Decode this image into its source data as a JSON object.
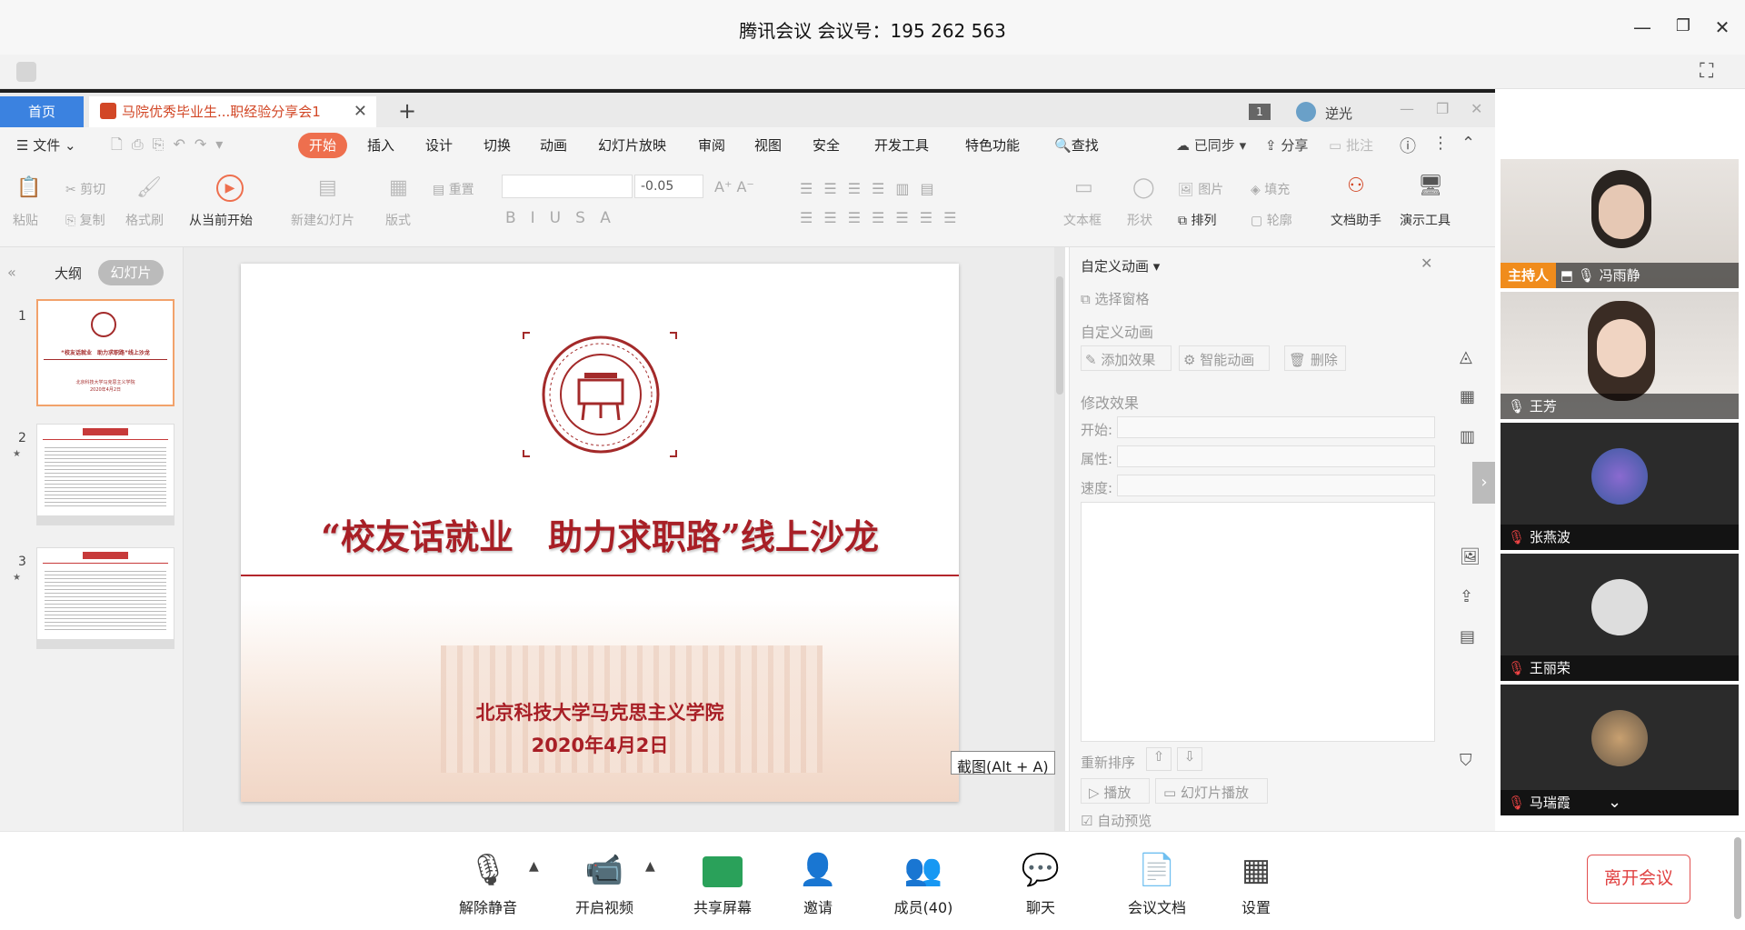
{
  "meeting": {
    "title": "腾讯会议 会议号：195 262 563",
    "leave_label": "离开会议",
    "toolbar": [
      {
        "label": "解除静音",
        "icon": "mic-muted-icon"
      },
      {
        "label": "开启视频",
        "icon": "video-off-icon"
      },
      {
        "label": "共享屏幕",
        "icon": "share-screen-icon"
      },
      {
        "label": "邀请",
        "icon": "invite-icon"
      },
      {
        "label": "成员(40)",
        "icon": "members-icon"
      },
      {
        "label": "聊天",
        "icon": "chat-icon"
      },
      {
        "label": "会议文档",
        "icon": "document-icon"
      },
      {
        "label": "设置",
        "icon": "settings-icon"
      }
    ],
    "participants": [
      {
        "name": "冯雨静",
        "role": "主持人"
      },
      {
        "name": "王芳"
      },
      {
        "name": "张燕波"
      },
      {
        "name": "王丽荣"
      },
      {
        "name": "马瑞霞"
      }
    ]
  },
  "wps": {
    "home_tab": "首页",
    "doc_tab": "马院优秀毕业生...职经验分享会1",
    "page_count": "1",
    "user_name": "逆光",
    "menu_file": "文件",
    "menu": [
      "开始",
      "插入",
      "设计",
      "切换",
      "动画",
      "幻灯片放映",
      "审阅",
      "视图",
      "安全",
      "开发工具",
      "特色功能"
    ],
    "search": "查找",
    "synced": "已同步",
    "share": "分享",
    "comment": "批注",
    "ribbon": {
      "paste": "粘贴",
      "cut": "剪切",
      "copy": "复制",
      "format_painter": "格式刷",
      "from_current": "从当前开始",
      "new_slide": "新建幻灯片",
      "layout": "版式",
      "reset": "重置",
      "font_size": "-0.05",
      "textbox": "文本框",
      "shape": "形状",
      "picture": "图片",
      "fill": "填充",
      "arrange": "排列",
      "outline": "轮廓",
      "doc_assistant": "文档助手",
      "presentation_tools": "演示工具"
    },
    "panel_tabs": [
      "大纲",
      "幻灯片"
    ],
    "slides": [
      {
        "num": "1"
      },
      {
        "num": "2"
      },
      {
        "num": "3"
      }
    ],
    "slide": {
      "title": "“校友话就业　助力求职路”线上沙龙",
      "org": "北京科技大学马克思主义学院",
      "date": "2020年4月2日"
    },
    "thumb1_title": "“校友话就业　助力求职路”线上沙龙",
    "anim": {
      "header": "自定义动画",
      "select_pane": "选择窗格",
      "section1": "自定义动画",
      "add_effect": "添加效果",
      "smart_anim": "智能动画",
      "delete": "删除",
      "section2": "修改效果",
      "start": "开始:",
      "property": "属性:",
      "speed": "速度:",
      "reorder": "重新排序",
      "play": "播放",
      "slideshow": "幻灯片播放",
      "auto_preview": "自动预览"
    },
    "tooltip": "截图(Alt + A)"
  }
}
